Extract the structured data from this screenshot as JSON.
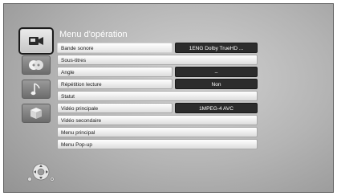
{
  "menu": {
    "title": "Menu d'opération"
  },
  "sidebar": {
    "icons": [
      {
        "name": "video-icon",
        "active": true
      },
      {
        "name": "disc-icon",
        "active": false
      },
      {
        "name": "music-icon",
        "active": false
      },
      {
        "name": "box-icon",
        "active": false
      }
    ]
  },
  "rows": [
    {
      "label": "Bande sonore",
      "value": "1ENG Dolby TrueHD ..."
    },
    {
      "label": "Sous-titres",
      "value": ""
    },
    {
      "label": "Angle",
      "value": "–"
    },
    {
      "label": "Répétition lecture",
      "value": "Non"
    },
    {
      "label": "Statut",
      "value": ""
    },
    {
      "label": "Vidéo principale",
      "value": "1MPEG-4 AVC"
    },
    {
      "label": "Vidéo secondaire",
      "value": ""
    },
    {
      "label": "Menu principal",
      "value": ""
    },
    {
      "label": "Menu Pop-up",
      "value": ""
    }
  ],
  "colors": {
    "value_dark": "#2c2c2c",
    "title_text": "#ffffff"
  },
  "footer": {
    "icon": "remote-navigation-icon"
  }
}
